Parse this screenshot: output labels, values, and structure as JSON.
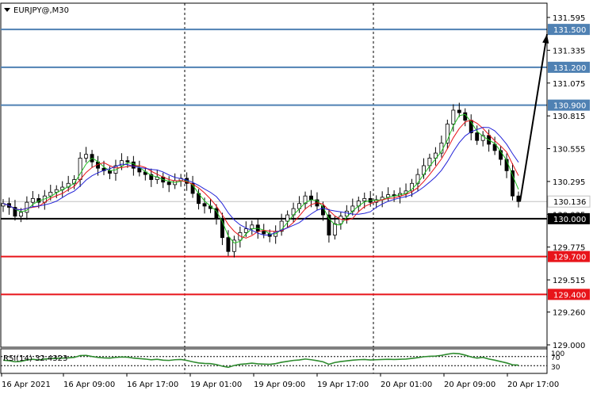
{
  "window": {
    "symbol_title": "EURJPY@,M30",
    "indicator_label": "RSI(14) 32.4323"
  },
  "colors": {
    "level_blue": "#4f81b3",
    "level_black": "#000000",
    "level_red": "#e8141a",
    "ma_fast": "#1fbf1f",
    "ma_mid": "#e8141a",
    "ma_slow": "#2323d8",
    "rsi_line": "#2e8b2e",
    "current_price_line": "#c0c0c0"
  },
  "chart_data": {
    "type": "candlestick",
    "symbol": "EURJPY",
    "timeframe": "M30",
    "y_ticks": [
      "131.595",
      "131.335",
      "131.075",
      "130.815",
      "130.555",
      "130.295",
      "130.035",
      "129.775",
      "129.515",
      "129.260",
      "129.000"
    ],
    "ylim": [
      129.0,
      131.7
    ],
    "x_ticks": [
      "16 Apr 2021",
      "16 Apr 09:00",
      "16 Apr 17:00",
      "19 Apr 01:00",
      "19 Apr 09:00",
      "19 Apr 17:00",
      "20 Apr 01:00",
      "20 Apr 09:00",
      "20 Apr 17:00"
    ],
    "session_separators": [
      "19 Apr 01:00",
      "20 Apr 01:00"
    ],
    "levels": [
      {
        "label": "131.500",
        "value": 131.5,
        "color": "blue"
      },
      {
        "label": "131.200",
        "value": 131.2,
        "color": "blue"
      },
      {
        "label": "130.900",
        "value": 130.9,
        "color": "blue"
      },
      {
        "label": "130.000",
        "value": 130.0,
        "color": "black"
      },
      {
        "label": "129.700",
        "value": 129.7,
        "color": "red"
      },
      {
        "label": "129.400",
        "value": 129.4,
        "color": "red"
      }
    ],
    "current_price": {
      "label": "130.136",
      "value": 130.136
    },
    "close": [
      130.12,
      130.09,
      130.02,
      130.05,
      130.13,
      130.16,
      130.13,
      130.18,
      130.21,
      130.23,
      130.25,
      130.28,
      130.31,
      130.48,
      130.51,
      130.45,
      130.4,
      130.38,
      130.36,
      130.42,
      130.46,
      130.45,
      130.4,
      130.37,
      130.35,
      130.31,
      130.33,
      130.29,
      130.27,
      130.3,
      130.32,
      130.28,
      130.2,
      130.12,
      130.1,
      130.08,
      130.0,
      129.85,
      129.74,
      129.83,
      129.89,
      129.92,
      129.95,
      129.9,
      129.88,
      129.86,
      129.9,
      129.98,
      130.03,
      130.08,
      130.12,
      130.18,
      130.15,
      130.1,
      130.03,
      129.87,
      129.96,
      130.02,
      130.06,
      130.1,
      130.14,
      130.16,
      130.13,
      130.15,
      130.17,
      130.19,
      130.18,
      130.2,
      130.22,
      130.28,
      130.35,
      130.42,
      130.48,
      130.52,
      130.6,
      130.75,
      130.86,
      130.84,
      130.78,
      130.68,
      130.62,
      130.66,
      130.59,
      130.54,
      130.47,
      130.38,
      130.18,
      130.136
    ],
    "rsi": {
      "label": "RSI(14) 32.4323",
      "levels": [
        70,
        30
      ],
      "range": [
        0,
        100
      ],
      "values": [
        54,
        52,
        47,
        49,
        55,
        58,
        55,
        59,
        61,
        62,
        63,
        64,
        66,
        74,
        75,
        70,
        66,
        64,
        63,
        66,
        68,
        67,
        63,
        61,
        59,
        56,
        58,
        54,
        53,
        56,
        57,
        53,
        47,
        42,
        40,
        39,
        35,
        28,
        23,
        31,
        36,
        38,
        41,
        38,
        37,
        36,
        39,
        45,
        49,
        53,
        55,
        59,
        56,
        52,
        47,
        36,
        44,
        48,
        51,
        54,
        56,
        57,
        55,
        56,
        57,
        58,
        57,
        58,
        59,
        62,
        65,
        69,
        71,
        72,
        75,
        80,
        84,
        82,
        76,
        68,
        63,
        66,
        59,
        54,
        48,
        42,
        34,
        32.43
      ]
    },
    "moving_averages": [
      {
        "color": "green",
        "period_hint": "fast"
      },
      {
        "color": "red",
        "period_hint": "medium"
      },
      {
        "color": "blue",
        "period_hint": "slow"
      }
    ],
    "annotation": "arrow pointing up toward 131.500"
  }
}
